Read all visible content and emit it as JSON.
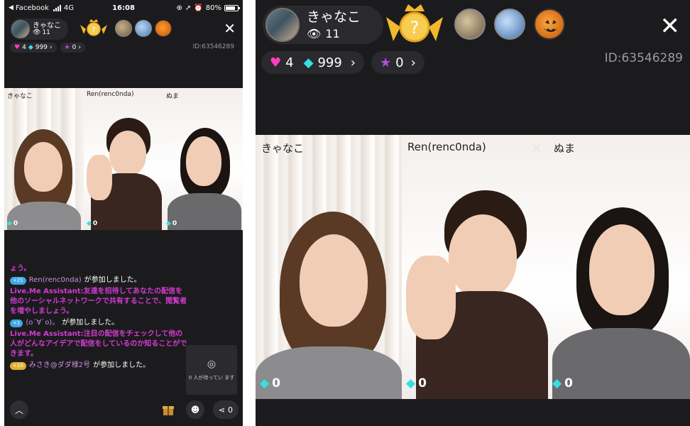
{
  "status_bar": {
    "back_app": "Facebook",
    "network": "4G",
    "time": "16:08",
    "battery_text": "80%",
    "battery_level": 0.8
  },
  "host": {
    "name": "きゃなこ",
    "viewers": "11"
  },
  "stats": {
    "hearts": "4",
    "diamonds": "999",
    "stars": "0",
    "room_id": "ID:63546289"
  },
  "participants": [
    {
      "name": "きゃなこ",
      "diamonds": "0"
    },
    {
      "name": "Ren(renc0nda)",
      "diamonds": "0"
    },
    {
      "name": "ぬま",
      "diamonds": "0"
    }
  ],
  "chat": {
    "lines": [
      {
        "type": "system",
        "text": "ょう。"
      },
      {
        "type": "join",
        "level": "+21",
        "user": "Ren(renc0nda)",
        "text": "が参加しました。"
      },
      {
        "type": "system",
        "text": "Live.Me Assistant:友達を招待してあなたの配信を他のソーシャルネットワークで共有することで、閲覧者を増やしましょう。"
      },
      {
        "type": "join",
        "level": "+1",
        "user": "(o´∀`o)。",
        "text": "が参加しました。"
      },
      {
        "type": "system",
        "text": "Live.Me Assistant:注目の配信をチェックして他の人がどんなアイデアで配信をしているのか知ることができます。"
      },
      {
        "type": "join",
        "level": "+10",
        "user": "みさき@ダダ様2号",
        "text": "が参加しました。"
      }
    ]
  },
  "waiting": {
    "text": "0 人が待ってい ます"
  },
  "bottom_bar": {
    "share_count": "0"
  },
  "colors": {
    "background": "#1b1b1d",
    "heart": "#ff3ebf",
    "diamond": "#33e0e6",
    "star": "#b14fe0",
    "chat_magenta": "#d23bd0",
    "level_badge_blue": "#3ea8e6",
    "level_badge_gold": "#e0b030"
  },
  "icons": [
    "eye-icon",
    "heart-icon",
    "diamond-icon",
    "star-icon",
    "crown-icon",
    "close-icon",
    "chevron-up-icon",
    "gift-icon",
    "mask-icon",
    "share-icon",
    "rings-icon"
  ]
}
